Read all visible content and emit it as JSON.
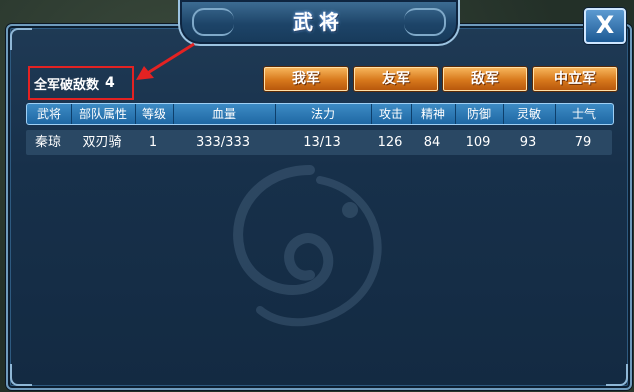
{
  "window": {
    "title": "武将",
    "close_label": "X"
  },
  "kills": {
    "label": "全军破敌数",
    "value": "4"
  },
  "factions": [
    {
      "label": "我军"
    },
    {
      "label": "友军"
    },
    {
      "label": "敌军"
    },
    {
      "label": "中立军"
    }
  ],
  "table": {
    "headers": [
      "武将",
      "部队属性",
      "等级",
      "血量",
      "法力",
      "攻击",
      "精神",
      "防御",
      "灵敏",
      "士气"
    ],
    "rows": [
      [
        "秦琼",
        "双刃骑",
        "1",
        "333/333",
        "13/13",
        "126",
        "84",
        "109",
        "93",
        "79"
      ]
    ]
  },
  "colors": {
    "annotation": "#e32222",
    "button_orange": "#d7781c",
    "header_blue": "#1f68a4"
  }
}
